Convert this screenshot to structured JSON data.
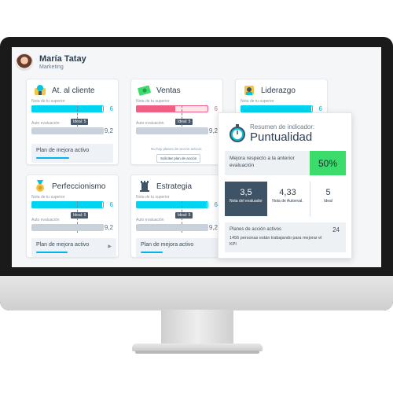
{
  "user": {
    "name": "María Tatay",
    "role": "Marketing"
  },
  "cards": {
    "at_cliente": {
      "title": "At. al cliente",
      "sup_label": "Nota de tu superior",
      "sup_value": "6",
      "ideal_label": "Ideal: 5",
      "auto_label": "Auto evaluación",
      "auto_value": "9,2",
      "plan_label": "Plan de mejora activo",
      "plan_progress": 0.55
    },
    "ventas": {
      "title": "Ventas",
      "sup_label": "Nota de tu superior",
      "sup_value": "6",
      "ideal_label": "Ideal: 5",
      "auto_label": "Auto evaluación",
      "auto_value": "9,2",
      "no_plans": "No hay planes de acción activos",
      "request_label": "Solicitar plan de acción"
    },
    "liderazgo": {
      "title": "Liderazgo",
      "sup_label": "Nota de tu superior",
      "sup_value": "6"
    },
    "perfeccionismo": {
      "title": "Perfeccionismo",
      "sup_label": "Nota de tu superior",
      "sup_value": "6",
      "ideal_label": "Ideal: 5",
      "auto_label": "Auto evaluación",
      "auto_value": "9,2",
      "plan_label": "Plan de mejora activo",
      "plan_progress": 0.5
    },
    "estrategia": {
      "title": "Estrategia",
      "sup_label": "Nota de tu superior",
      "sup_value": "6",
      "ideal_label": "Ideal: 5",
      "auto_label": "Auto evaluación",
      "auto_value": "9,2",
      "plan_label": "Plan de mejora activo",
      "plan_progress": 0.32
    }
  },
  "summary": {
    "subtitle": "Resumen de indicador:",
    "title": "Puntualidad",
    "mejora_label": "Mejora respecto a la anterior evaluación",
    "mejora_value": "50%",
    "scores": [
      {
        "value": "3,5",
        "label": "Nota del evaluador"
      },
      {
        "value": "4,33",
        "label": "Nota de Autoeval."
      },
      {
        "value": "5",
        "label": "Ideal"
      }
    ],
    "planes_title": "Planes de acción activos",
    "planes_count": "24",
    "planes_desc": "1456 personas están trabajando para mejorar el KPI"
  },
  "colors": {
    "cyan": "#00d4f0",
    "pink": "#f25f85",
    "gray_bar": "#c9d2da",
    "green": "#3cdc6c",
    "navy": "#3e5366"
  }
}
